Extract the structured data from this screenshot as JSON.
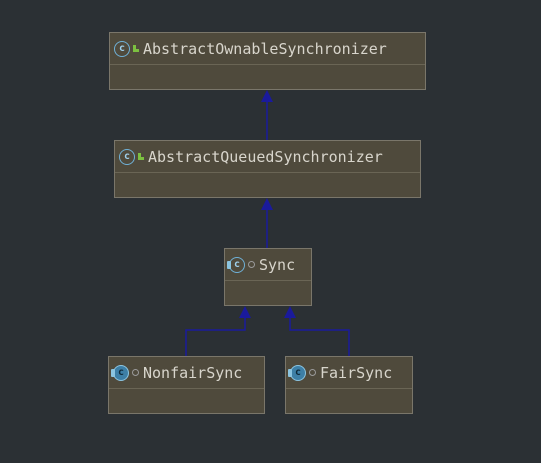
{
  "nodes": {
    "aos": {
      "name": "AbstractOwnableSynchronizer",
      "icon": "abstract-class-icon",
      "modifier": "public-icon"
    },
    "aqs": {
      "name": "AbstractQueuedSynchronizer",
      "icon": "abstract-class-icon",
      "modifier": "public-icon"
    },
    "sync": {
      "name": "Sync",
      "icon": "abstract-class-icon",
      "modifier": "package-private-icon"
    },
    "nonfair": {
      "name": "NonfairSync",
      "icon": "class-icon",
      "modifier": "package-private-icon"
    },
    "fair": {
      "name": "FairSync",
      "icon": "class-icon",
      "modifier": "package-private-icon"
    }
  },
  "edges": [
    {
      "from": "aqs",
      "to": "aos",
      "type": "extends"
    },
    {
      "from": "sync",
      "to": "aqs",
      "type": "extends"
    },
    {
      "from": "nonfair",
      "to": "sync",
      "type": "extends"
    },
    {
      "from": "fair",
      "to": "sync",
      "type": "extends"
    }
  ],
  "colors": {
    "background": "#2b3034",
    "node_fill": "#4f4a3c",
    "edge": "#1a1a9c"
  }
}
